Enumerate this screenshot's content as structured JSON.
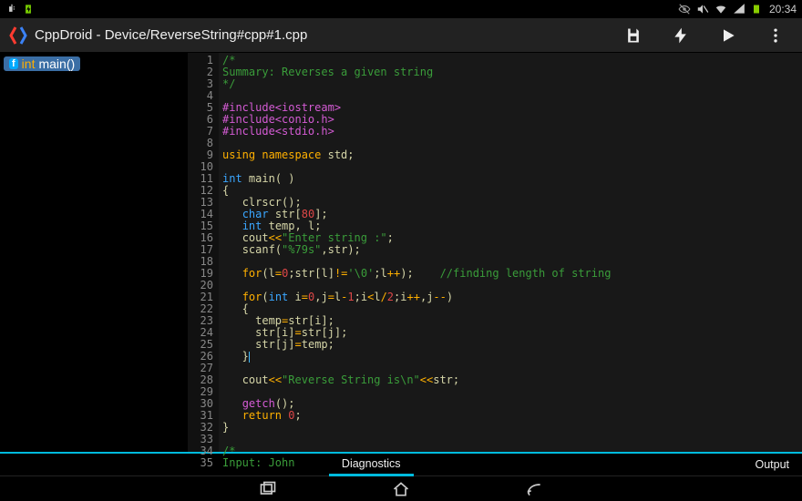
{
  "statusbar": {
    "left_icons": [
      "usb-icon",
      "battery-charging-icon"
    ],
    "right_icons": [
      "eye-off-icon",
      "mute-icon",
      "wifi-icon",
      "signal-icon",
      "battery-icon"
    ],
    "time": "20:34"
  },
  "header": {
    "title": "CppDroid - Device/ReverseString#cpp#1.cpp",
    "buttons": {
      "save": "save-icon",
      "build": "bolt-icon",
      "run": "play-icon",
      "menu": "overflow-icon"
    }
  },
  "sidebar": {
    "func": {
      "type_kw": "int",
      "name": "main()"
    }
  },
  "code": {
    "lines": [
      [
        {
          "cls": "c-comment",
          "t": "/*"
        }
      ],
      [
        {
          "cls": "c-comment",
          "t": "Summary: Reverses a given string"
        }
      ],
      [
        {
          "cls": "c-comment",
          "t": "*/"
        }
      ],
      [],
      [
        {
          "cls": "c-pre",
          "t": "#include<iostream>"
        }
      ],
      [
        {
          "cls": "c-pre",
          "t": "#include<conio.h>"
        }
      ],
      [
        {
          "cls": "c-pre",
          "t": "#include<stdio.h>"
        }
      ],
      [],
      [
        {
          "cls": "c-kw",
          "t": "using namespace "
        },
        {
          "cls": "c-id",
          "t": "std"
        },
        {
          "cls": "c-punc",
          "t": ";"
        }
      ],
      [],
      [
        {
          "cls": "c-type",
          "t": "int "
        },
        {
          "cls": "c-id",
          "t": "main"
        },
        {
          "cls": "c-punc",
          "t": "( )"
        }
      ],
      [
        {
          "cls": "c-punc",
          "t": "{"
        }
      ],
      [
        {
          "cls": "c-punc",
          "t": "   "
        },
        {
          "cls": "c-id",
          "t": "clrscr"
        },
        {
          "cls": "c-punc",
          "t": "();"
        }
      ],
      [
        {
          "cls": "c-punc",
          "t": "   "
        },
        {
          "cls": "c-type",
          "t": "char "
        },
        {
          "cls": "c-id",
          "t": "str"
        },
        {
          "cls": "c-punc",
          "t": "["
        },
        {
          "cls": "c-num",
          "t": "80"
        },
        {
          "cls": "c-punc",
          "t": "];"
        }
      ],
      [
        {
          "cls": "c-punc",
          "t": "   "
        },
        {
          "cls": "c-type",
          "t": "int "
        },
        {
          "cls": "c-id",
          "t": "temp"
        },
        {
          "cls": "c-punc",
          "t": ", "
        },
        {
          "cls": "c-id",
          "t": "l"
        },
        {
          "cls": "c-punc",
          "t": ";"
        }
      ],
      [
        {
          "cls": "c-punc",
          "t": "   "
        },
        {
          "cls": "c-id",
          "t": "cout"
        },
        {
          "cls": "c-op",
          "t": "<<"
        },
        {
          "cls": "c-str",
          "t": "\"Enter string :\""
        },
        {
          "cls": "c-punc",
          "t": ";"
        }
      ],
      [
        {
          "cls": "c-punc",
          "t": "   "
        },
        {
          "cls": "c-id",
          "t": "scanf"
        },
        {
          "cls": "c-punc",
          "t": "("
        },
        {
          "cls": "c-str",
          "t": "\"%79s\""
        },
        {
          "cls": "c-punc",
          "t": ","
        },
        {
          "cls": "c-id",
          "t": "str"
        },
        {
          "cls": "c-punc",
          "t": ");"
        }
      ],
      [],
      [
        {
          "cls": "c-punc",
          "t": "   "
        },
        {
          "cls": "c-kw",
          "t": "for"
        },
        {
          "cls": "c-punc",
          "t": "("
        },
        {
          "cls": "c-id",
          "t": "l"
        },
        {
          "cls": "c-op",
          "t": "="
        },
        {
          "cls": "c-num",
          "t": "0"
        },
        {
          "cls": "c-punc",
          "t": ";"
        },
        {
          "cls": "c-id",
          "t": "str"
        },
        {
          "cls": "c-punc",
          "t": "["
        },
        {
          "cls": "c-id",
          "t": "l"
        },
        {
          "cls": "c-punc",
          "t": "]"
        },
        {
          "cls": "c-op",
          "t": "!="
        },
        {
          "cls": "c-str",
          "t": "'\\0'"
        },
        {
          "cls": "c-punc",
          "t": ";"
        },
        {
          "cls": "c-id",
          "t": "l"
        },
        {
          "cls": "c-op",
          "t": "++"
        },
        {
          "cls": "c-punc",
          "t": ");    "
        },
        {
          "cls": "c-comment",
          "t": "//finding length of string"
        }
      ],
      [],
      [
        {
          "cls": "c-punc",
          "t": "   "
        },
        {
          "cls": "c-kw",
          "t": "for"
        },
        {
          "cls": "c-punc",
          "t": "("
        },
        {
          "cls": "c-type",
          "t": "int "
        },
        {
          "cls": "c-id",
          "t": "i"
        },
        {
          "cls": "c-op",
          "t": "="
        },
        {
          "cls": "c-num",
          "t": "0"
        },
        {
          "cls": "c-punc",
          "t": ","
        },
        {
          "cls": "c-id",
          "t": "j"
        },
        {
          "cls": "c-op",
          "t": "="
        },
        {
          "cls": "c-id",
          "t": "l"
        },
        {
          "cls": "c-op",
          "t": "-"
        },
        {
          "cls": "c-num",
          "t": "1"
        },
        {
          "cls": "c-punc",
          "t": ";"
        },
        {
          "cls": "c-id",
          "t": "i"
        },
        {
          "cls": "c-op",
          "t": "<"
        },
        {
          "cls": "c-id",
          "t": "l"
        },
        {
          "cls": "c-op",
          "t": "/"
        },
        {
          "cls": "c-num",
          "t": "2"
        },
        {
          "cls": "c-punc",
          "t": ";"
        },
        {
          "cls": "c-id",
          "t": "i"
        },
        {
          "cls": "c-op",
          "t": "++"
        },
        {
          "cls": "c-punc",
          "t": ","
        },
        {
          "cls": "c-id",
          "t": "j"
        },
        {
          "cls": "c-op",
          "t": "--"
        },
        {
          "cls": "c-punc",
          "t": ")"
        }
      ],
      [
        {
          "cls": "c-punc",
          "t": "   {"
        }
      ],
      [
        {
          "cls": "c-punc",
          "t": "     "
        },
        {
          "cls": "c-id",
          "t": "temp"
        },
        {
          "cls": "c-op",
          "t": "="
        },
        {
          "cls": "c-id",
          "t": "str"
        },
        {
          "cls": "c-punc",
          "t": "["
        },
        {
          "cls": "c-id",
          "t": "i"
        },
        {
          "cls": "c-punc",
          "t": "];"
        }
      ],
      [
        {
          "cls": "c-punc",
          "t": "     "
        },
        {
          "cls": "c-id",
          "t": "str"
        },
        {
          "cls": "c-punc",
          "t": "["
        },
        {
          "cls": "c-id",
          "t": "i"
        },
        {
          "cls": "c-punc",
          "t": "]"
        },
        {
          "cls": "c-op",
          "t": "="
        },
        {
          "cls": "c-id",
          "t": "str"
        },
        {
          "cls": "c-punc",
          "t": "["
        },
        {
          "cls": "c-id",
          "t": "j"
        },
        {
          "cls": "c-punc",
          "t": "];"
        }
      ],
      [
        {
          "cls": "c-punc",
          "t": "     "
        },
        {
          "cls": "c-id",
          "t": "str"
        },
        {
          "cls": "c-punc",
          "t": "["
        },
        {
          "cls": "c-id",
          "t": "j"
        },
        {
          "cls": "c-punc",
          "t": "]"
        },
        {
          "cls": "c-op",
          "t": "="
        },
        {
          "cls": "c-id",
          "t": "temp"
        },
        {
          "cls": "c-punc",
          "t": ";"
        }
      ],
      [
        {
          "cls": "c-punc",
          "t": "   }"
        },
        {
          "cls": "cursor",
          "t": ""
        }
      ],
      [],
      [
        {
          "cls": "c-punc",
          "t": "   "
        },
        {
          "cls": "c-id",
          "t": "cout"
        },
        {
          "cls": "c-op",
          "t": "<<"
        },
        {
          "cls": "c-str",
          "t": "\"Reverse String is\\n\""
        },
        {
          "cls": "c-op",
          "t": "<<"
        },
        {
          "cls": "c-id",
          "t": "str"
        },
        {
          "cls": "c-punc",
          "t": ";"
        }
      ],
      [],
      [
        {
          "cls": "c-punc",
          "t": "   "
        },
        {
          "cls": "c-fn",
          "t": "getch"
        },
        {
          "cls": "c-punc",
          "t": "();"
        }
      ],
      [
        {
          "cls": "c-punc",
          "t": "   "
        },
        {
          "cls": "c-kw",
          "t": "return "
        },
        {
          "cls": "c-num",
          "t": "0"
        },
        {
          "cls": "c-punc",
          "t": ";"
        }
      ],
      [
        {
          "cls": "c-punc",
          "t": "}"
        }
      ],
      [],
      [
        {
          "cls": "c-comment",
          "t": "/*"
        }
      ],
      [
        {
          "cls": "c-comment",
          "t": "Input: John"
        }
      ]
    ]
  },
  "bottomtabs": {
    "diagnostics": "Diagnostics",
    "output": "Output"
  }
}
